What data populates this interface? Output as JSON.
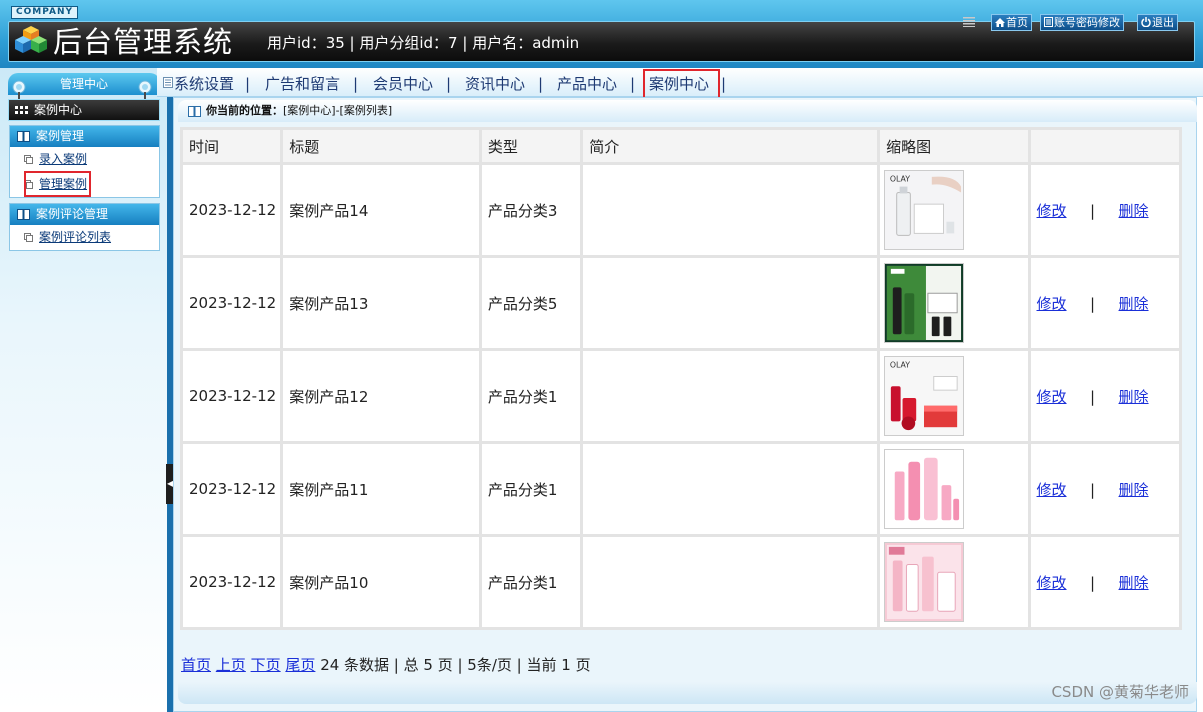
{
  "header": {
    "company": "COMPANY",
    "title": "后台管理系统",
    "user_info": "用户id：35 | 用户分组id：7 | 用户名：admin",
    "buttons": {
      "home": "首页",
      "account": "账号密码修改",
      "logout": "退出"
    }
  },
  "sidebar": {
    "center_title": "管理中心",
    "current_module": "案例中心",
    "groups": [
      {
        "title": "案例管理",
        "items": [
          "录入案例",
          "管理案例"
        ]
      },
      {
        "title": "案例评论管理",
        "items": [
          "案例评论列表"
        ]
      }
    ]
  },
  "nav": {
    "items": [
      "系统设置",
      "广告和留言",
      "会员中心",
      "资讯中心",
      "产品中心",
      "案例中心"
    ],
    "separator": "|"
  },
  "breadcrumb": {
    "label": "你当前的位置：",
    "path": "[案例中心]-[案例列表]"
  },
  "table": {
    "headers": [
      "时间",
      "标题",
      "类型",
      "简介",
      "缩略图",
      ""
    ],
    "rows": [
      {
        "time": "2023-12-12",
        "title": "案例产品14",
        "type": "产品分类3",
        "intro": "",
        "thumb": "olay-white-serum",
        "edit": "修改",
        "sep": "|",
        "delete": "删除"
      },
      {
        "time": "2023-12-12",
        "title": "案例产品13",
        "type": "产品分类5",
        "intro": "",
        "thumb": "green-skincare-set",
        "edit": "修改",
        "sep": "|",
        "delete": "删除"
      },
      {
        "time": "2023-12-12",
        "title": "案例产品12",
        "type": "产品分类1",
        "intro": "",
        "thumb": "olay-red-set",
        "edit": "修改",
        "sep": "|",
        "delete": "删除"
      },
      {
        "time": "2023-12-12",
        "title": "案例产品11",
        "type": "产品分类1",
        "intro": "",
        "thumb": "pink-bottles",
        "edit": "修改",
        "sep": "|",
        "delete": "删除"
      },
      {
        "time": "2023-12-12",
        "title": "案例产品10",
        "type": "产品分类1",
        "intro": "",
        "thumb": "pink-gift-set",
        "edit": "修改",
        "sep": "|",
        "delete": "删除"
      }
    ]
  },
  "pager": {
    "first": "首页",
    "prev": "上页",
    "next": "下页",
    "last": "尾页",
    "summary": "24 条数据 | 总 5 页 | 5条/页 | 当前 1 页"
  },
  "watermark": "CSDN @黄菊华老师",
  "colors": {
    "highlight_frame": "#e0262d",
    "link": "#1a2fd8",
    "header_blue": "#2f9fd6"
  }
}
